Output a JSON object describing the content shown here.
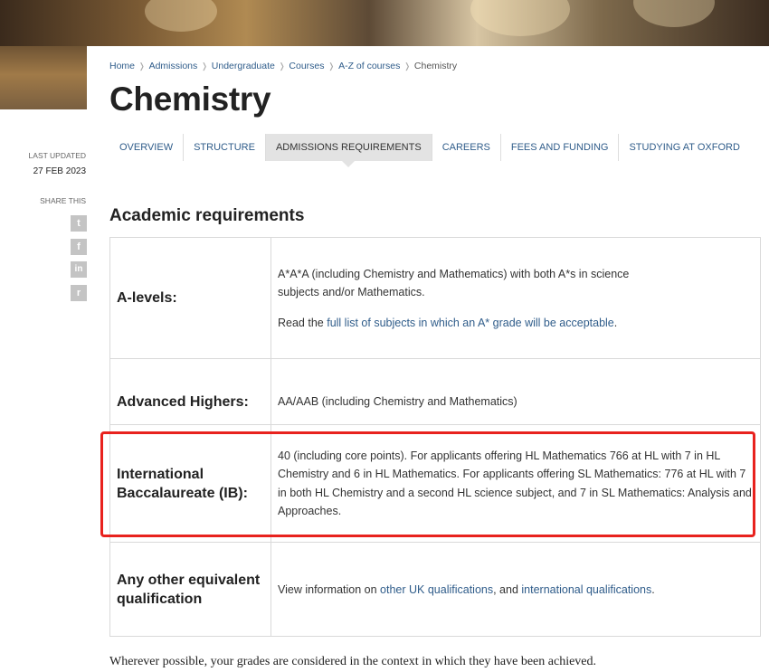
{
  "breadcrumb": {
    "items": [
      "Home",
      "Admissions",
      "Undergraduate",
      "Courses",
      "A-Z of courses"
    ],
    "current": "Chemistry",
    "separator": "❭"
  },
  "page_title": "Chemistry",
  "tabs": [
    {
      "label": "OVERVIEW",
      "active": false
    },
    {
      "label": "STRUCTURE",
      "active": false
    },
    {
      "label": "ADMISSIONS REQUIREMENTS",
      "active": true
    },
    {
      "label": "CAREERS",
      "active": false
    },
    {
      "label": "FEES AND FUNDING",
      "active": false
    },
    {
      "label": "STUDYING AT OXFORD",
      "active": false
    }
  ],
  "sidebar": {
    "last_updated_label": "LAST UPDATED",
    "last_updated_date": "27 FEB 2023",
    "share_label": "SHARE THIS",
    "share_icons": [
      {
        "name": "twitter-icon",
        "glyph": "t"
      },
      {
        "name": "facebook-icon",
        "glyph": "f"
      },
      {
        "name": "linkedin-icon",
        "glyph": "in"
      },
      {
        "name": "reddit-icon",
        "glyph": "r"
      }
    ]
  },
  "section_heading": "Academic requirements",
  "requirements": {
    "alevels": {
      "label": "A-levels:",
      "text": "A*A*A (including Chemistry and Mathematics) with both A*s in science subjects and/or Mathematics.",
      "read_prefix": "Read the ",
      "read_link": "full list of subjects in which an A* grade will be acceptable",
      "read_suffix": "."
    },
    "advanced_highers": {
      "label": "Advanced Highers:",
      "text": "AA/AAB (including Chemistry and Mathematics)"
    },
    "ib": {
      "label": "International Baccalaureate (IB):",
      "text": "40 (including core points). For applicants offering HL Mathematics 766 at HL with 7 in HL Chemistry and 6 in HL Mathematics. For applicants offering SL Mathematics: 776 at HL with 7 in both HL Chemistry and a second HL science subject, and 7 in SL Mathematics: Analysis and Approaches."
    },
    "other": {
      "label": "Any other equivalent qualification",
      "prefix": "View information on ",
      "link1": "other UK qualifications",
      "middle": ", and ",
      "link2": "international qualifications",
      "suffix": "."
    }
  },
  "footnote": "Wherever possible, your grades are considered in the context in which they have been achieved.",
  "colors": {
    "link": "#2f5c8a",
    "highlight": "#e8221e",
    "active_tab_bg": "#e3e3e3"
  }
}
